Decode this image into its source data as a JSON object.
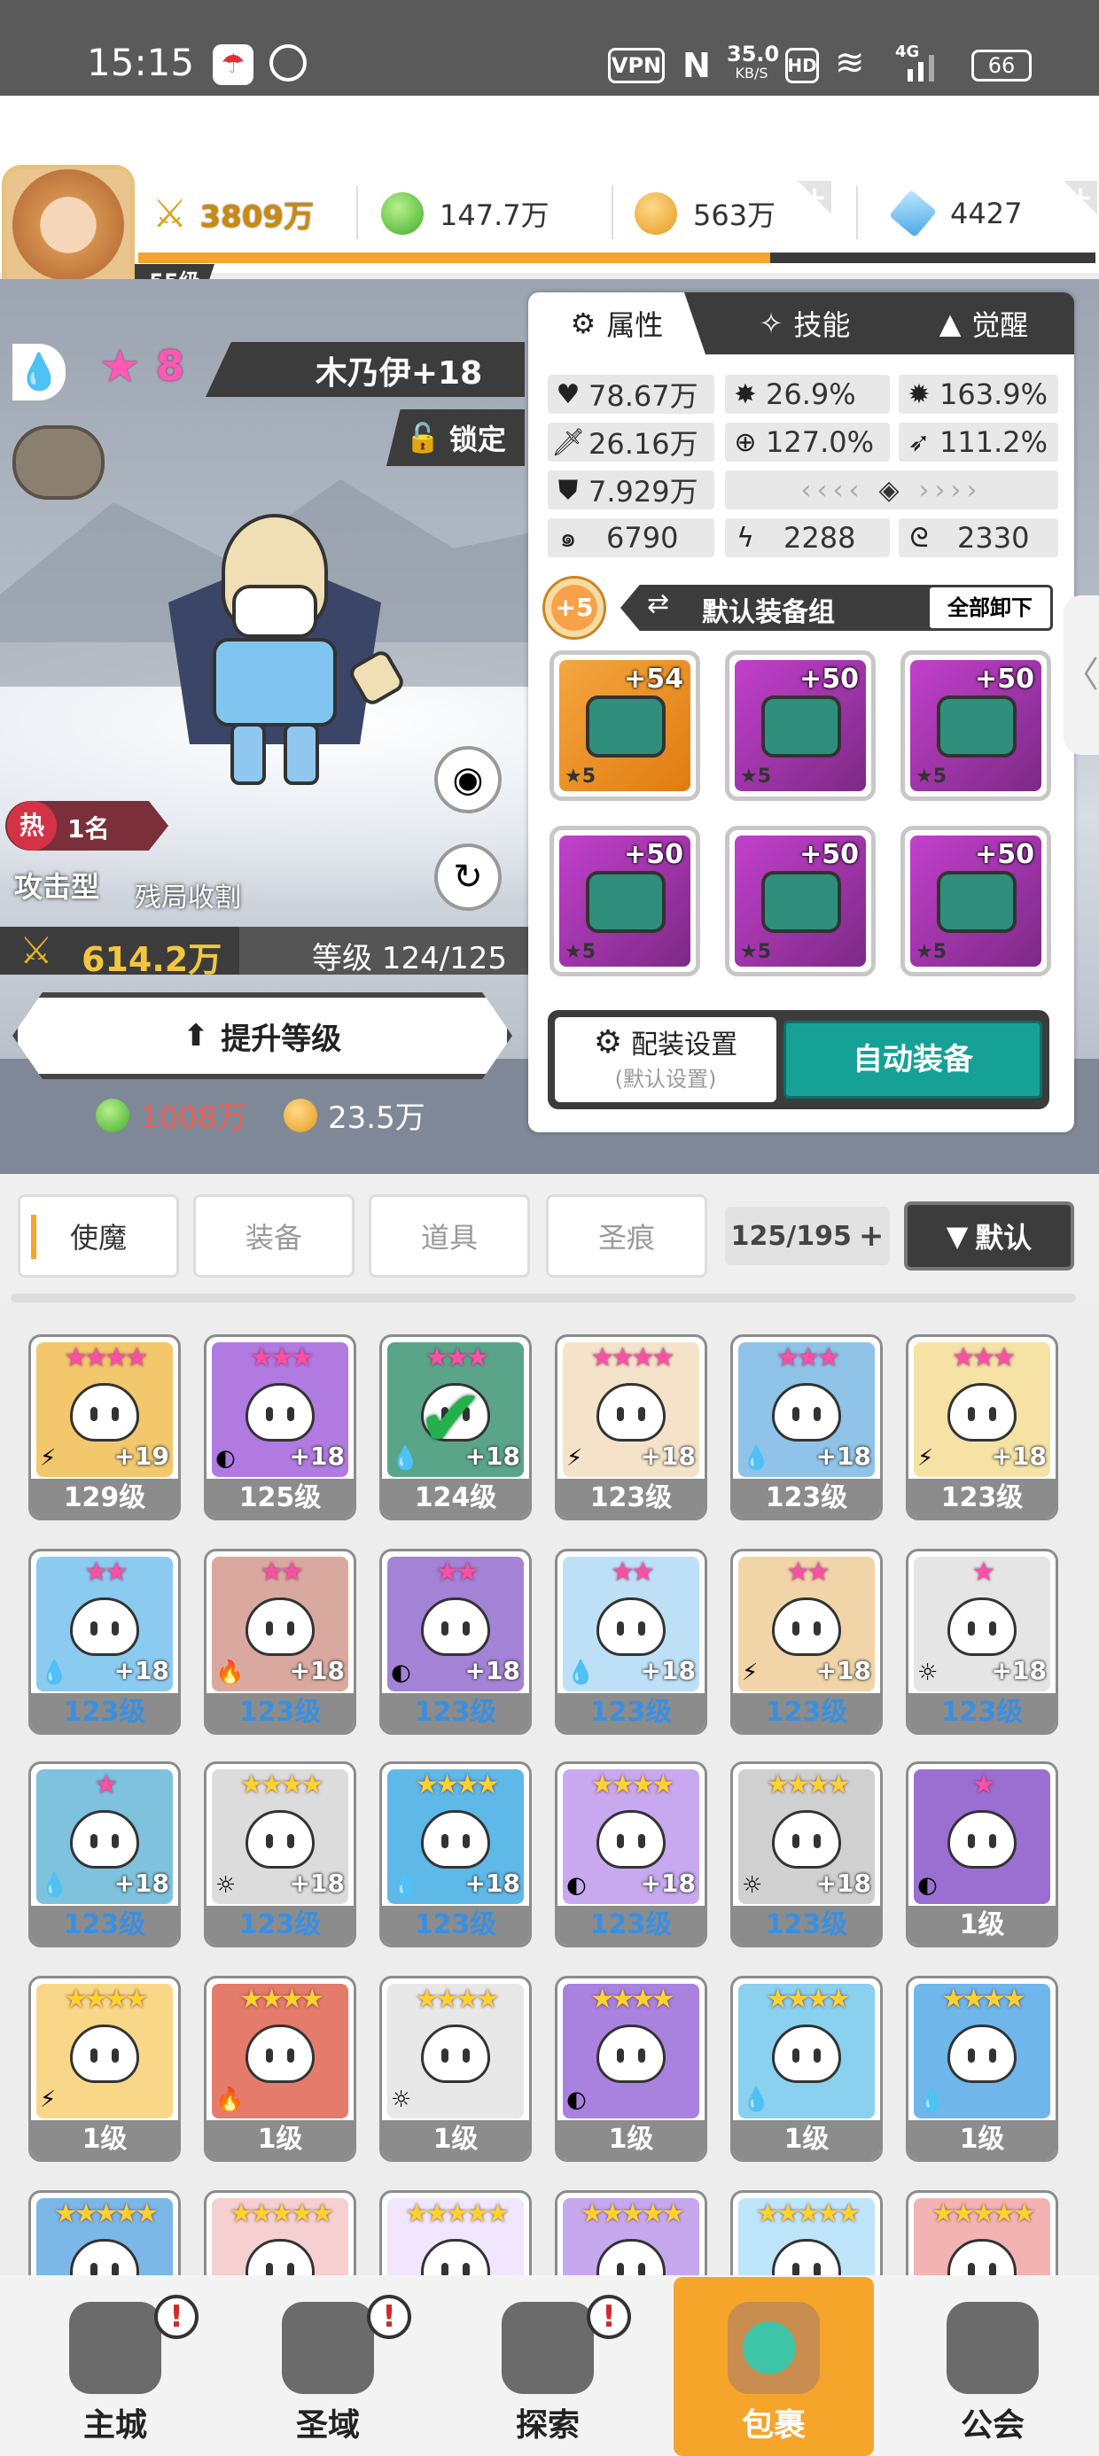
{
  "status_bar": {
    "time": "15:15",
    "vpn": "VPN",
    "net_speed_value": "35.0",
    "net_speed_unit": "KB/S",
    "hd": "HD",
    "signal_label": "4G",
    "battery": "66"
  },
  "player": {
    "level": "55级",
    "power": "3809万",
    "green_gems": "147.7万",
    "gold": "563万",
    "crystals": "4427"
  },
  "hero": {
    "star_count": "8",
    "name": "木乃伊+18",
    "lock_label": "锁定",
    "hot_rank": "1名",
    "type": "攻击型",
    "role": "残局收割",
    "power": "614.2万",
    "level_text": "等级 124/125",
    "upgrade_button": "提升等级",
    "upgrade_cost_green": "1008万",
    "upgrade_cost_gold": "23.5万"
  },
  "panel": {
    "tabs": [
      "属性",
      "技能",
      "觉醒"
    ],
    "stats": {
      "hp": "78.67万",
      "crit": "26.9%",
      "crit_damage": "163.9%",
      "attack": "26.16万",
      "accuracy": "127.0%",
      "speed": "111.2%",
      "defense": "7.929万",
      "stat_a": "6790",
      "stat_b": "2288",
      "stat_c": "2330"
    },
    "equip_bonus": "+5",
    "equip_set_label": "默认装备组",
    "unequip_all": "全部卸下",
    "equipment": [
      {
        "level": "+54",
        "stars": "★5",
        "color": "#f0941f",
        "icon": "sword-icon"
      },
      {
        "level": "+50",
        "stars": "★5",
        "color": "#c240cc",
        "icon": "helmet-icon"
      },
      {
        "level": "+50",
        "stars": "★5",
        "color": "#c240cc",
        "icon": "armor-icon"
      },
      {
        "level": "+50",
        "stars": "★5",
        "color": "#c240cc",
        "icon": "belt-icon"
      },
      {
        "level": "+50",
        "stars": "★5",
        "color": "#c240cc",
        "icon": "necklace-icon"
      },
      {
        "level": "+50",
        "stars": "★5",
        "color": "#c240cc",
        "icon": "boots-icon"
      }
    ],
    "loadout_settings": "配装设置",
    "loadout_default": "(默认设置)",
    "auto_equip": "自动装备"
  },
  "inventory_tabs": {
    "tabs": [
      "使魔",
      "装备",
      "道具",
      "圣痕"
    ],
    "capacity": "125/195",
    "sort_label": "默认"
  },
  "heroes": [
    {
      "stars": "★★★★",
      "plus": "+19",
      "level": "129级",
      "elem": "⚡",
      "color": "#f3c76b"
    },
    {
      "stars": "★★★",
      "plus": "+18",
      "level": "125级",
      "elem": "◐",
      "color": "#b07ae0"
    },
    {
      "stars": "★★★",
      "plus": "+18",
      "level": "124级",
      "elem": "💧",
      "color": "#5aa58a"
    },
    {
      "stars": "★★★★",
      "plus": "+18",
      "level": "123级",
      "elem": "⚡",
      "color": "#f4e3c8"
    },
    {
      "stars": "★★★",
      "plus": "+18",
      "level": "123级",
      "elem": "💧",
      "color": "#8fc3e8"
    },
    {
      "stars": "★★★",
      "plus": "+18",
      "level": "123级",
      "elem": "⚡",
      "color": "#f5e2a4"
    },
    {
      "stars": "★★",
      "plus": "+18",
      "level": "123级",
      "elem": "💧",
      "color": "#8ccbf0"
    },
    {
      "stars": "★★",
      "plus": "+18",
      "level": "123级",
      "elem": "🔥",
      "color": "#d9a9a0"
    },
    {
      "stars": "★★",
      "plus": "+18",
      "level": "123级",
      "elem": "◐",
      "color": "#a383d6"
    },
    {
      "stars": "★★",
      "plus": "+18",
      "level": "123级",
      "elem": "💧",
      "color": "#bde0f7"
    },
    {
      "stars": "★★",
      "plus": "+18",
      "level": "123级",
      "elem": "⚡",
      "color": "#f1d5a8"
    },
    {
      "stars": "★",
      "plus": "+18",
      "level": "123级",
      "elem": "☼",
      "color": "#e5e5e5"
    },
    {
      "stars": "★",
      "plus": "+18",
      "level": "123级",
      "elem": "💧",
      "color": "#7ec2de"
    },
    {
      "stars": "★★★★",
      "plus": "+18",
      "level": "123级",
      "elem": "☼",
      "color": "#dcdcdc"
    },
    {
      "stars": "★★★★",
      "plus": "+18",
      "level": "123级",
      "elem": "💧",
      "color": "#5eb8e8"
    },
    {
      "stars": "★★★★",
      "plus": "+18",
      "level": "123级",
      "elem": "◐",
      "color": "#c8a8ef"
    },
    {
      "stars": "★★★★",
      "plus": "+18",
      "level": "123级",
      "elem": "☼",
      "color": "#d0d0d0"
    },
    {
      "stars": "★",
      "plus": "",
      "level": "1级",
      "elem": "◐",
      "color": "#9a6fd1"
    },
    {
      "stars": "★★★★",
      "plus": "",
      "level": "1级",
      "elem": "⚡",
      "color": "#f8d888"
    },
    {
      "stars": "★★★★",
      "plus": "",
      "level": "1级",
      "elem": "🔥",
      "color": "#e47b6b"
    },
    {
      "stars": "★★★★",
      "plus": "",
      "level": "1级",
      "elem": "☼",
      "color": "#e8e8e8"
    },
    {
      "stars": "★★★★",
      "plus": "",
      "level": "1级",
      "elem": "◐",
      "color": "#a982e0"
    },
    {
      "stars": "★★★★",
      "plus": "",
      "level": "1级",
      "elem": "💧",
      "color": "#8ad0ef"
    },
    {
      "stars": "★★★★",
      "plus": "",
      "level": "1级",
      "elem": "💧",
      "color": "#6fb6ea"
    }
  ],
  "bottom_nav": [
    {
      "label": "主城",
      "icon": "castle-icon"
    },
    {
      "label": "圣域",
      "icon": "portal-icon"
    },
    {
      "label": "探索",
      "icon": "sword-explore-icon"
    },
    {
      "label": "包裹",
      "icon": "bag-icon"
    },
    {
      "label": "公会",
      "icon": "guild-icon"
    }
  ]
}
